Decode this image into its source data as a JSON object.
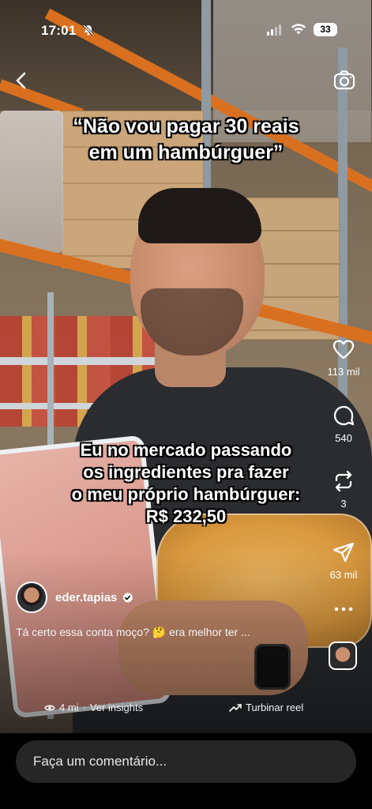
{
  "status_bar": {
    "time": "17:01",
    "battery": "33",
    "icons": [
      "bell-slash-icon",
      "signal-icon",
      "wifi-icon",
      "battery-icon"
    ]
  },
  "top_bar": {
    "icons": [
      "chevron-left-icon",
      "camera-icon"
    ]
  },
  "captions": {
    "top_line1": "“Não vou pagar 30 reais",
    "top_line2": "em um hambúrguer”",
    "mid_line1": "Eu no mercado passando",
    "mid_line2": "os ingredientes pra fazer",
    "mid_line3": "o meu próprio hambúrguer:",
    "mid_line4": "R$ 232,50"
  },
  "actions": {
    "likes": "113 mil",
    "comments": "540",
    "reposts": "3",
    "shares": "63 mil"
  },
  "author": {
    "username": "eder.tapias",
    "verified": true
  },
  "post": {
    "description": "Tá certo essa conta moço? 🤔 era melhor ter ...",
    "views": "4 mi",
    "separator": "·",
    "insights_label": "Ver insights",
    "boost_label": "Turbinar reel"
  },
  "comment_input": {
    "placeholder": "Faça um comentário..."
  },
  "colors": {
    "bottom_bar": "#000000",
    "input_bg": "#262626",
    "verified": "#ffffff"
  }
}
